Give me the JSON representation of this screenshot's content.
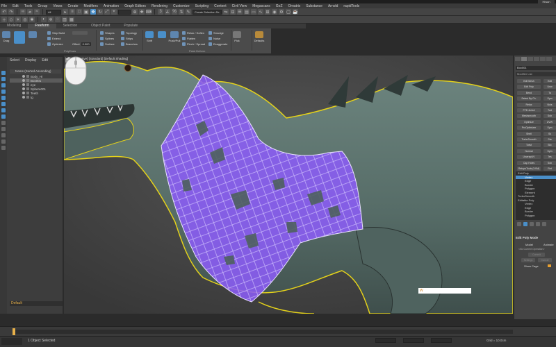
{
  "title_bar": {
    "user": "Hiwan"
  },
  "menu": [
    "File",
    "Edit",
    "Tools",
    "Group",
    "Views",
    "Create",
    "Modifiers",
    "Animation",
    "Graph Editors",
    "Rendering",
    "Customize",
    "Scripting",
    "Content",
    "Civil View",
    "Megascans",
    "GoZ",
    "Ornatrix",
    "Substance",
    "Arnold",
    "rapidTools"
  ],
  "toolbar": {
    "filter_value": "All",
    "selection_set_placeholder": "Create Selection Se"
  },
  "ribbon": {
    "tabs": [
      "Modeling",
      "Freeform",
      "Selection",
      "Object Paint",
      "Populate"
    ],
    "active_tab": "Freeform",
    "groups": {
      "polydraw": {
        "drag": "Drag",
        "step_build": "Step Build",
        "extend": "Extend",
        "optimize": "Optimize",
        "offset_label": "Offset",
        "offset_value": "0.000",
        "footer": "PolyDraw"
      },
      "shapes": {
        "shapes": "Shapes",
        "topology": "Topology",
        "splines": "Splines",
        "strips": "Strips",
        "surface": "Surface",
        "branches": "Branches"
      },
      "paint_deform": {
        "shift": "Shift",
        "push_pull": "Push/Pull",
        "relax_soften": "Relax / Soften",
        "flatten": "Flatten",
        "pinch_spread": "Pinch / Spread",
        "smudge": "Smudge",
        "noise": "Noise",
        "exaggerate": "Exaggerate",
        "footer": "Paint Deform"
      },
      "pick": "Pick",
      "defaults": "Defaults"
    }
  },
  "scene_explorer": {
    "menu": [
      "Select",
      "Display",
      "Edit"
    ],
    "header": "Name (Sorted Ascending)",
    "items": [
      {
        "name": "Body_Hi",
        "selected": false
      },
      {
        "name": "Box001",
        "selected": true
      },
      {
        "name": "eye",
        "selected": false
      },
      {
        "name": "Sphere001",
        "selected": false
      },
      {
        "name": "Teeth",
        "selected": false
      },
      {
        "name": "tg",
        "selected": false
      }
    ],
    "layer": "Default"
  },
  "viewport": {
    "label": "[+] [Perspective] [Standard] [Default Shading]",
    "tooltip_text": "W"
  },
  "command_panel": {
    "object_name": "Box001",
    "modifier_list": "Modifier List",
    "buttons_left": [
      "Edit Mesh",
      "Edit Poly",
      "Bend",
      "Select By Ch.",
      "Relax",
      "FFD 4x4x4",
      "Meshsmooth",
      "Optimize",
      "ProOptimizer",
      "Shell",
      "TurboSmooth",
      "Twist",
      "Normal",
      "UnwrapUV",
      "Cap Holes",
      "RetopoTools (VXM)"
    ],
    "buttons_right": [
      "Edit",
      "Unw",
      "Ta",
      "Sym",
      "Nois",
      "Turt",
      "Sub",
      "UVW",
      "Sym",
      "Sk",
      "Sta",
      "Slic",
      "Sym",
      "Tes",
      "Sub",
      "Ret"
    ],
    "stack": [
      {
        "label": "Edit Poly",
        "indent": 0,
        "selected": false
      },
      {
        "label": "Vertex",
        "indent": 1,
        "selected": true
      },
      {
        "label": "Edge",
        "indent": 1,
        "selected": false
      },
      {
        "label": "Border",
        "indent": 1,
        "selected": false
      },
      {
        "label": "Polygon",
        "indent": 1,
        "selected": false
      },
      {
        "label": "Element",
        "indent": 1,
        "selected": false
      },
      {
        "label": "TurboSmooth",
        "indent": 0,
        "selected": false
      },
      {
        "label": "Editable Poly",
        "indent": 0,
        "selected": false
      },
      {
        "label": "Vertex",
        "indent": 1,
        "selected": false
      },
      {
        "label": "Edge",
        "indent": 1,
        "selected": false
      },
      {
        "label": "Border",
        "indent": 1,
        "selected": false
      },
      {
        "label": "Polygon",
        "indent": 1,
        "selected": false
      }
    ],
    "rollout_title": "Edit Poly Mode",
    "mode_model": "Model",
    "mode_animate": "Animate",
    "current_operation": "<No Current Operation>",
    "commit": "Commit",
    "settings": "Settings",
    "cancel": "Cancel",
    "show_cage": "Show Cage"
  },
  "timeline": {
    "frame": "0 / 100"
  },
  "status": {
    "message": "1 Object Selected",
    "grid": "Grid = 10.0cm"
  },
  "colors": {
    "accent": "#4a8fc9",
    "cage": "#8b5cf6",
    "creature": "#5f7670",
    "outline": "#e5d21a",
    "highlight": "#e8b14a"
  }
}
